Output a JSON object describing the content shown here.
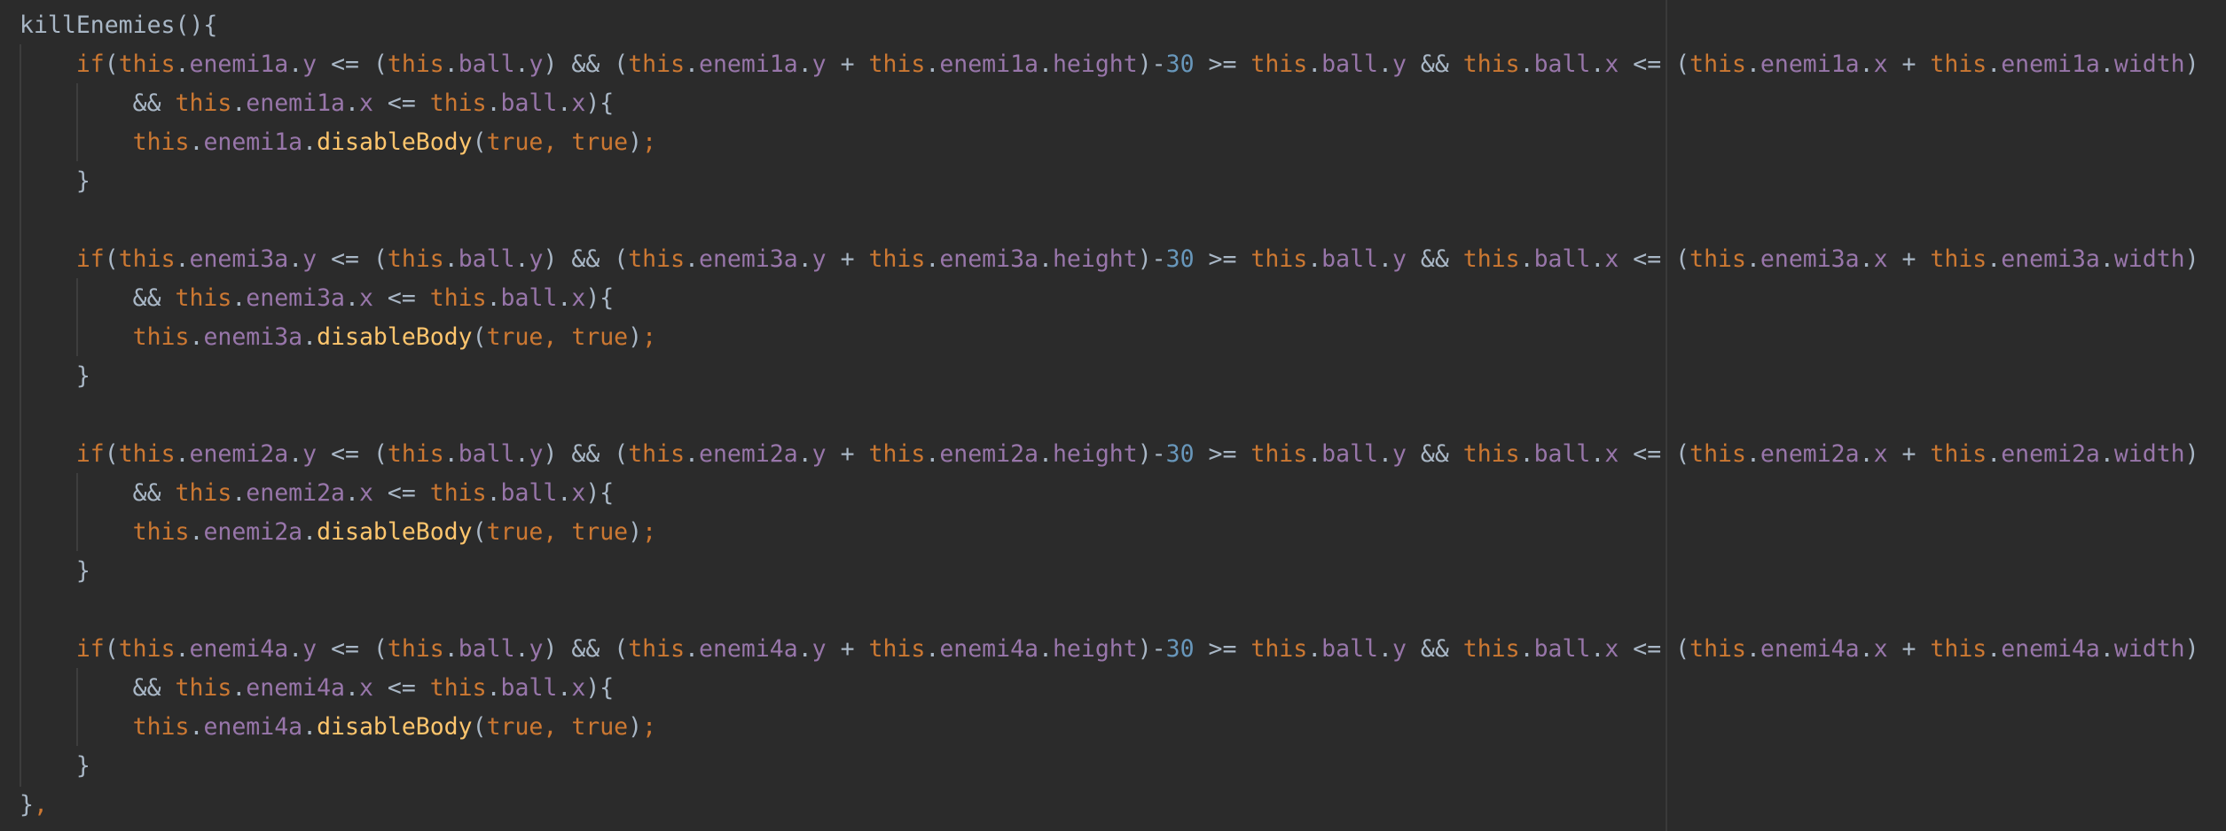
{
  "editor": {
    "colors": {
      "background": "#2b2b2b",
      "default": "#a9b7c6",
      "keyword": "#cc7832",
      "property": "#9876aa",
      "function": "#ffc66d",
      "number": "#6897bb"
    },
    "lines": [
      [
        [
          "pl",
          "killEnemies(){"
        ]
      ],
      [
        [
          "pl",
          "    "
        ],
        [
          "kw",
          "if"
        ],
        [
          "pl",
          "("
        ],
        [
          "kw",
          "this"
        ],
        [
          "pl",
          "."
        ],
        [
          "pr",
          "enemi1a"
        ],
        [
          "pl",
          "."
        ],
        [
          "pr",
          "y"
        ],
        [
          "pl",
          " <= ("
        ],
        [
          "kw",
          "this"
        ],
        [
          "pl",
          "."
        ],
        [
          "pr",
          "ball"
        ],
        [
          "pl",
          "."
        ],
        [
          "pr",
          "y"
        ],
        [
          "pl",
          ") && ("
        ],
        [
          "kw",
          "this"
        ],
        [
          "pl",
          "."
        ],
        [
          "pr",
          "enemi1a"
        ],
        [
          "pl",
          "."
        ],
        [
          "pr",
          "y"
        ],
        [
          "pl",
          " + "
        ],
        [
          "kw",
          "this"
        ],
        [
          "pl",
          "."
        ],
        [
          "pr",
          "enemi1a"
        ],
        [
          "pl",
          "."
        ],
        [
          "pr",
          "height"
        ],
        [
          "pl",
          ")-"
        ],
        [
          "num",
          "30"
        ],
        [
          "pl",
          " >= "
        ],
        [
          "kw",
          "this"
        ],
        [
          "pl",
          "."
        ],
        [
          "pr",
          "ball"
        ],
        [
          "pl",
          "."
        ],
        [
          "pr",
          "y"
        ],
        [
          "pl",
          " && "
        ],
        [
          "kw",
          "this"
        ],
        [
          "pl",
          "."
        ],
        [
          "pr",
          "ball"
        ],
        [
          "pl",
          "."
        ],
        [
          "pr",
          "x"
        ],
        [
          "pl",
          " <= ("
        ],
        [
          "kw",
          "this"
        ],
        [
          "pl",
          "."
        ],
        [
          "pr",
          "enemi1a"
        ],
        [
          "pl",
          "."
        ],
        [
          "pr",
          "x"
        ],
        [
          "pl",
          " + "
        ],
        [
          "kw",
          "this"
        ],
        [
          "pl",
          "."
        ],
        [
          "pr",
          "enemi1a"
        ],
        [
          "pl",
          "."
        ],
        [
          "pr",
          "width"
        ],
        [
          "pl",
          ")"
        ]
      ],
      [
        [
          "pl",
          "        && "
        ],
        [
          "kw",
          "this"
        ],
        [
          "pl",
          "."
        ],
        [
          "pr",
          "enemi1a"
        ],
        [
          "pl",
          "."
        ],
        [
          "pr",
          "x"
        ],
        [
          "pl",
          " <= "
        ],
        [
          "kw",
          "this"
        ],
        [
          "pl",
          "."
        ],
        [
          "pr",
          "ball"
        ],
        [
          "pl",
          "."
        ],
        [
          "pr",
          "x"
        ],
        [
          "pl",
          "){"
        ]
      ],
      [
        [
          "pl",
          "        "
        ],
        [
          "kw",
          "this"
        ],
        [
          "pl",
          "."
        ],
        [
          "pr",
          "enemi1a"
        ],
        [
          "pl",
          "."
        ],
        [
          "fn",
          "disableBody"
        ],
        [
          "pl",
          "("
        ],
        [
          "kw",
          "true"
        ],
        [
          "kw",
          ", "
        ],
        [
          "kw",
          "true"
        ],
        [
          "pl",
          ")"
        ],
        [
          "kw",
          ";"
        ]
      ],
      [
        [
          "pl",
          "    }"
        ]
      ],
      [
        [
          "pl",
          ""
        ]
      ],
      [
        [
          "pl",
          "    "
        ],
        [
          "kw",
          "if"
        ],
        [
          "pl",
          "("
        ],
        [
          "kw",
          "this"
        ],
        [
          "pl",
          "."
        ],
        [
          "pr",
          "enemi3a"
        ],
        [
          "pl",
          "."
        ],
        [
          "pr",
          "y"
        ],
        [
          "pl",
          " <= ("
        ],
        [
          "kw",
          "this"
        ],
        [
          "pl",
          "."
        ],
        [
          "pr",
          "ball"
        ],
        [
          "pl",
          "."
        ],
        [
          "pr",
          "y"
        ],
        [
          "pl",
          ") && ("
        ],
        [
          "kw",
          "this"
        ],
        [
          "pl",
          "."
        ],
        [
          "pr",
          "enemi3a"
        ],
        [
          "pl",
          "."
        ],
        [
          "pr",
          "y"
        ],
        [
          "pl",
          " + "
        ],
        [
          "kw",
          "this"
        ],
        [
          "pl",
          "."
        ],
        [
          "pr",
          "enemi3a"
        ],
        [
          "pl",
          "."
        ],
        [
          "pr",
          "height"
        ],
        [
          "pl",
          ")-"
        ],
        [
          "num",
          "30"
        ],
        [
          "pl",
          " >= "
        ],
        [
          "kw",
          "this"
        ],
        [
          "pl",
          "."
        ],
        [
          "pr",
          "ball"
        ],
        [
          "pl",
          "."
        ],
        [
          "pr",
          "y"
        ],
        [
          "pl",
          " && "
        ],
        [
          "kw",
          "this"
        ],
        [
          "pl",
          "."
        ],
        [
          "pr",
          "ball"
        ],
        [
          "pl",
          "."
        ],
        [
          "pr",
          "x"
        ],
        [
          "pl",
          " <= ("
        ],
        [
          "kw",
          "this"
        ],
        [
          "pl",
          "."
        ],
        [
          "pr",
          "enemi3a"
        ],
        [
          "pl",
          "."
        ],
        [
          "pr",
          "x"
        ],
        [
          "pl",
          " + "
        ],
        [
          "kw",
          "this"
        ],
        [
          "pl",
          "."
        ],
        [
          "pr",
          "enemi3a"
        ],
        [
          "pl",
          "."
        ],
        [
          "pr",
          "width"
        ],
        [
          "pl",
          ")"
        ]
      ],
      [
        [
          "pl",
          "        && "
        ],
        [
          "kw",
          "this"
        ],
        [
          "pl",
          "."
        ],
        [
          "pr",
          "enemi3a"
        ],
        [
          "pl",
          "."
        ],
        [
          "pr",
          "x"
        ],
        [
          "pl",
          " <= "
        ],
        [
          "kw",
          "this"
        ],
        [
          "pl",
          "."
        ],
        [
          "pr",
          "ball"
        ],
        [
          "pl",
          "."
        ],
        [
          "pr",
          "x"
        ],
        [
          "pl",
          "){"
        ]
      ],
      [
        [
          "pl",
          "        "
        ],
        [
          "kw",
          "this"
        ],
        [
          "pl",
          "."
        ],
        [
          "pr",
          "enemi3a"
        ],
        [
          "pl",
          "."
        ],
        [
          "fn",
          "disableBody"
        ],
        [
          "pl",
          "("
        ],
        [
          "kw",
          "true"
        ],
        [
          "kw",
          ", "
        ],
        [
          "kw",
          "true"
        ],
        [
          "pl",
          ")"
        ],
        [
          "kw",
          ";"
        ]
      ],
      [
        [
          "pl",
          "    }"
        ]
      ],
      [
        [
          "pl",
          ""
        ]
      ],
      [
        [
          "pl",
          "    "
        ],
        [
          "kw",
          "if"
        ],
        [
          "pl",
          "("
        ],
        [
          "kw",
          "this"
        ],
        [
          "pl",
          "."
        ],
        [
          "pr",
          "enemi2a"
        ],
        [
          "pl",
          "."
        ],
        [
          "pr",
          "y"
        ],
        [
          "pl",
          " <= ("
        ],
        [
          "kw",
          "this"
        ],
        [
          "pl",
          "."
        ],
        [
          "pr",
          "ball"
        ],
        [
          "pl",
          "."
        ],
        [
          "pr",
          "y"
        ],
        [
          "pl",
          ") && ("
        ],
        [
          "kw",
          "this"
        ],
        [
          "pl",
          "."
        ],
        [
          "pr",
          "enemi2a"
        ],
        [
          "pl",
          "."
        ],
        [
          "pr",
          "y"
        ],
        [
          "pl",
          " + "
        ],
        [
          "kw",
          "this"
        ],
        [
          "pl",
          "."
        ],
        [
          "pr",
          "enemi2a"
        ],
        [
          "pl",
          "."
        ],
        [
          "pr",
          "height"
        ],
        [
          "pl",
          ")-"
        ],
        [
          "num",
          "30"
        ],
        [
          "pl",
          " >= "
        ],
        [
          "kw",
          "this"
        ],
        [
          "pl",
          "."
        ],
        [
          "pr",
          "ball"
        ],
        [
          "pl",
          "."
        ],
        [
          "pr",
          "y"
        ],
        [
          "pl",
          " && "
        ],
        [
          "kw",
          "this"
        ],
        [
          "pl",
          "."
        ],
        [
          "pr",
          "ball"
        ],
        [
          "pl",
          "."
        ],
        [
          "pr",
          "x"
        ],
        [
          "pl",
          " <= ("
        ],
        [
          "kw",
          "this"
        ],
        [
          "pl",
          "."
        ],
        [
          "pr",
          "enemi2a"
        ],
        [
          "pl",
          "."
        ],
        [
          "pr",
          "x"
        ],
        [
          "pl",
          " + "
        ],
        [
          "kw",
          "this"
        ],
        [
          "pl",
          "."
        ],
        [
          "pr",
          "enemi2a"
        ],
        [
          "pl",
          "."
        ],
        [
          "pr",
          "width"
        ],
        [
          "pl",
          ")"
        ]
      ],
      [
        [
          "pl",
          "        && "
        ],
        [
          "kw",
          "this"
        ],
        [
          "pl",
          "."
        ],
        [
          "pr",
          "enemi2a"
        ],
        [
          "pl",
          "."
        ],
        [
          "pr",
          "x"
        ],
        [
          "pl",
          " <= "
        ],
        [
          "kw",
          "this"
        ],
        [
          "pl",
          "."
        ],
        [
          "pr",
          "ball"
        ],
        [
          "pl",
          "."
        ],
        [
          "pr",
          "x"
        ],
        [
          "pl",
          "){"
        ]
      ],
      [
        [
          "pl",
          "        "
        ],
        [
          "kw",
          "this"
        ],
        [
          "pl",
          "."
        ],
        [
          "pr",
          "enemi2a"
        ],
        [
          "pl",
          "."
        ],
        [
          "fn",
          "disableBody"
        ],
        [
          "pl",
          "("
        ],
        [
          "kw",
          "true"
        ],
        [
          "kw",
          ", "
        ],
        [
          "kw",
          "true"
        ],
        [
          "pl",
          ")"
        ],
        [
          "kw",
          ";"
        ]
      ],
      [
        [
          "pl",
          "    }"
        ]
      ],
      [
        [
          "pl",
          ""
        ]
      ],
      [
        [
          "pl",
          "    "
        ],
        [
          "kw",
          "if"
        ],
        [
          "pl",
          "("
        ],
        [
          "kw",
          "this"
        ],
        [
          "pl",
          "."
        ],
        [
          "pr",
          "enemi4a"
        ],
        [
          "pl",
          "."
        ],
        [
          "pr",
          "y"
        ],
        [
          "pl",
          " <= ("
        ],
        [
          "kw",
          "this"
        ],
        [
          "pl",
          "."
        ],
        [
          "pr",
          "ball"
        ],
        [
          "pl",
          "."
        ],
        [
          "pr",
          "y"
        ],
        [
          "pl",
          ") && ("
        ],
        [
          "kw",
          "this"
        ],
        [
          "pl",
          "."
        ],
        [
          "pr",
          "enemi4a"
        ],
        [
          "pl",
          "."
        ],
        [
          "pr",
          "y"
        ],
        [
          "pl",
          " + "
        ],
        [
          "kw",
          "this"
        ],
        [
          "pl",
          "."
        ],
        [
          "pr",
          "enemi4a"
        ],
        [
          "pl",
          "."
        ],
        [
          "pr",
          "height"
        ],
        [
          "pl",
          ")-"
        ],
        [
          "num",
          "30"
        ],
        [
          "pl",
          " >= "
        ],
        [
          "kw",
          "this"
        ],
        [
          "pl",
          "."
        ],
        [
          "pr",
          "ball"
        ],
        [
          "pl",
          "."
        ],
        [
          "pr",
          "y"
        ],
        [
          "pl",
          " && "
        ],
        [
          "kw",
          "this"
        ],
        [
          "pl",
          "."
        ],
        [
          "pr",
          "ball"
        ],
        [
          "pl",
          "."
        ],
        [
          "pr",
          "x"
        ],
        [
          "pl",
          " <= ("
        ],
        [
          "kw",
          "this"
        ],
        [
          "pl",
          "."
        ],
        [
          "pr",
          "enemi4a"
        ],
        [
          "pl",
          "."
        ],
        [
          "pr",
          "x"
        ],
        [
          "pl",
          " + "
        ],
        [
          "kw",
          "this"
        ],
        [
          "pl",
          "."
        ],
        [
          "pr",
          "enemi4a"
        ],
        [
          "pl",
          "."
        ],
        [
          "pr",
          "width"
        ],
        [
          "pl",
          ")"
        ]
      ],
      [
        [
          "pl",
          "        && "
        ],
        [
          "kw",
          "this"
        ],
        [
          "pl",
          "."
        ],
        [
          "pr",
          "enemi4a"
        ],
        [
          "pl",
          "."
        ],
        [
          "pr",
          "x"
        ],
        [
          "pl",
          " <= "
        ],
        [
          "kw",
          "this"
        ],
        [
          "pl",
          "."
        ],
        [
          "pr",
          "ball"
        ],
        [
          "pl",
          "."
        ],
        [
          "pr",
          "x"
        ],
        [
          "pl",
          "){"
        ]
      ],
      [
        [
          "pl",
          "        "
        ],
        [
          "kw",
          "this"
        ],
        [
          "pl",
          "."
        ],
        [
          "pr",
          "enemi4a"
        ],
        [
          "pl",
          "."
        ],
        [
          "fn",
          "disableBody"
        ],
        [
          "pl",
          "("
        ],
        [
          "kw",
          "true"
        ],
        [
          "kw",
          ", "
        ],
        [
          "kw",
          "true"
        ],
        [
          "pl",
          ")"
        ],
        [
          "kw",
          ";"
        ]
      ],
      [
        [
          "pl",
          "    }"
        ]
      ],
      [
        [
          "pl",
          "}"
        ],
        [
          "kw",
          ","
        ]
      ]
    ]
  }
}
